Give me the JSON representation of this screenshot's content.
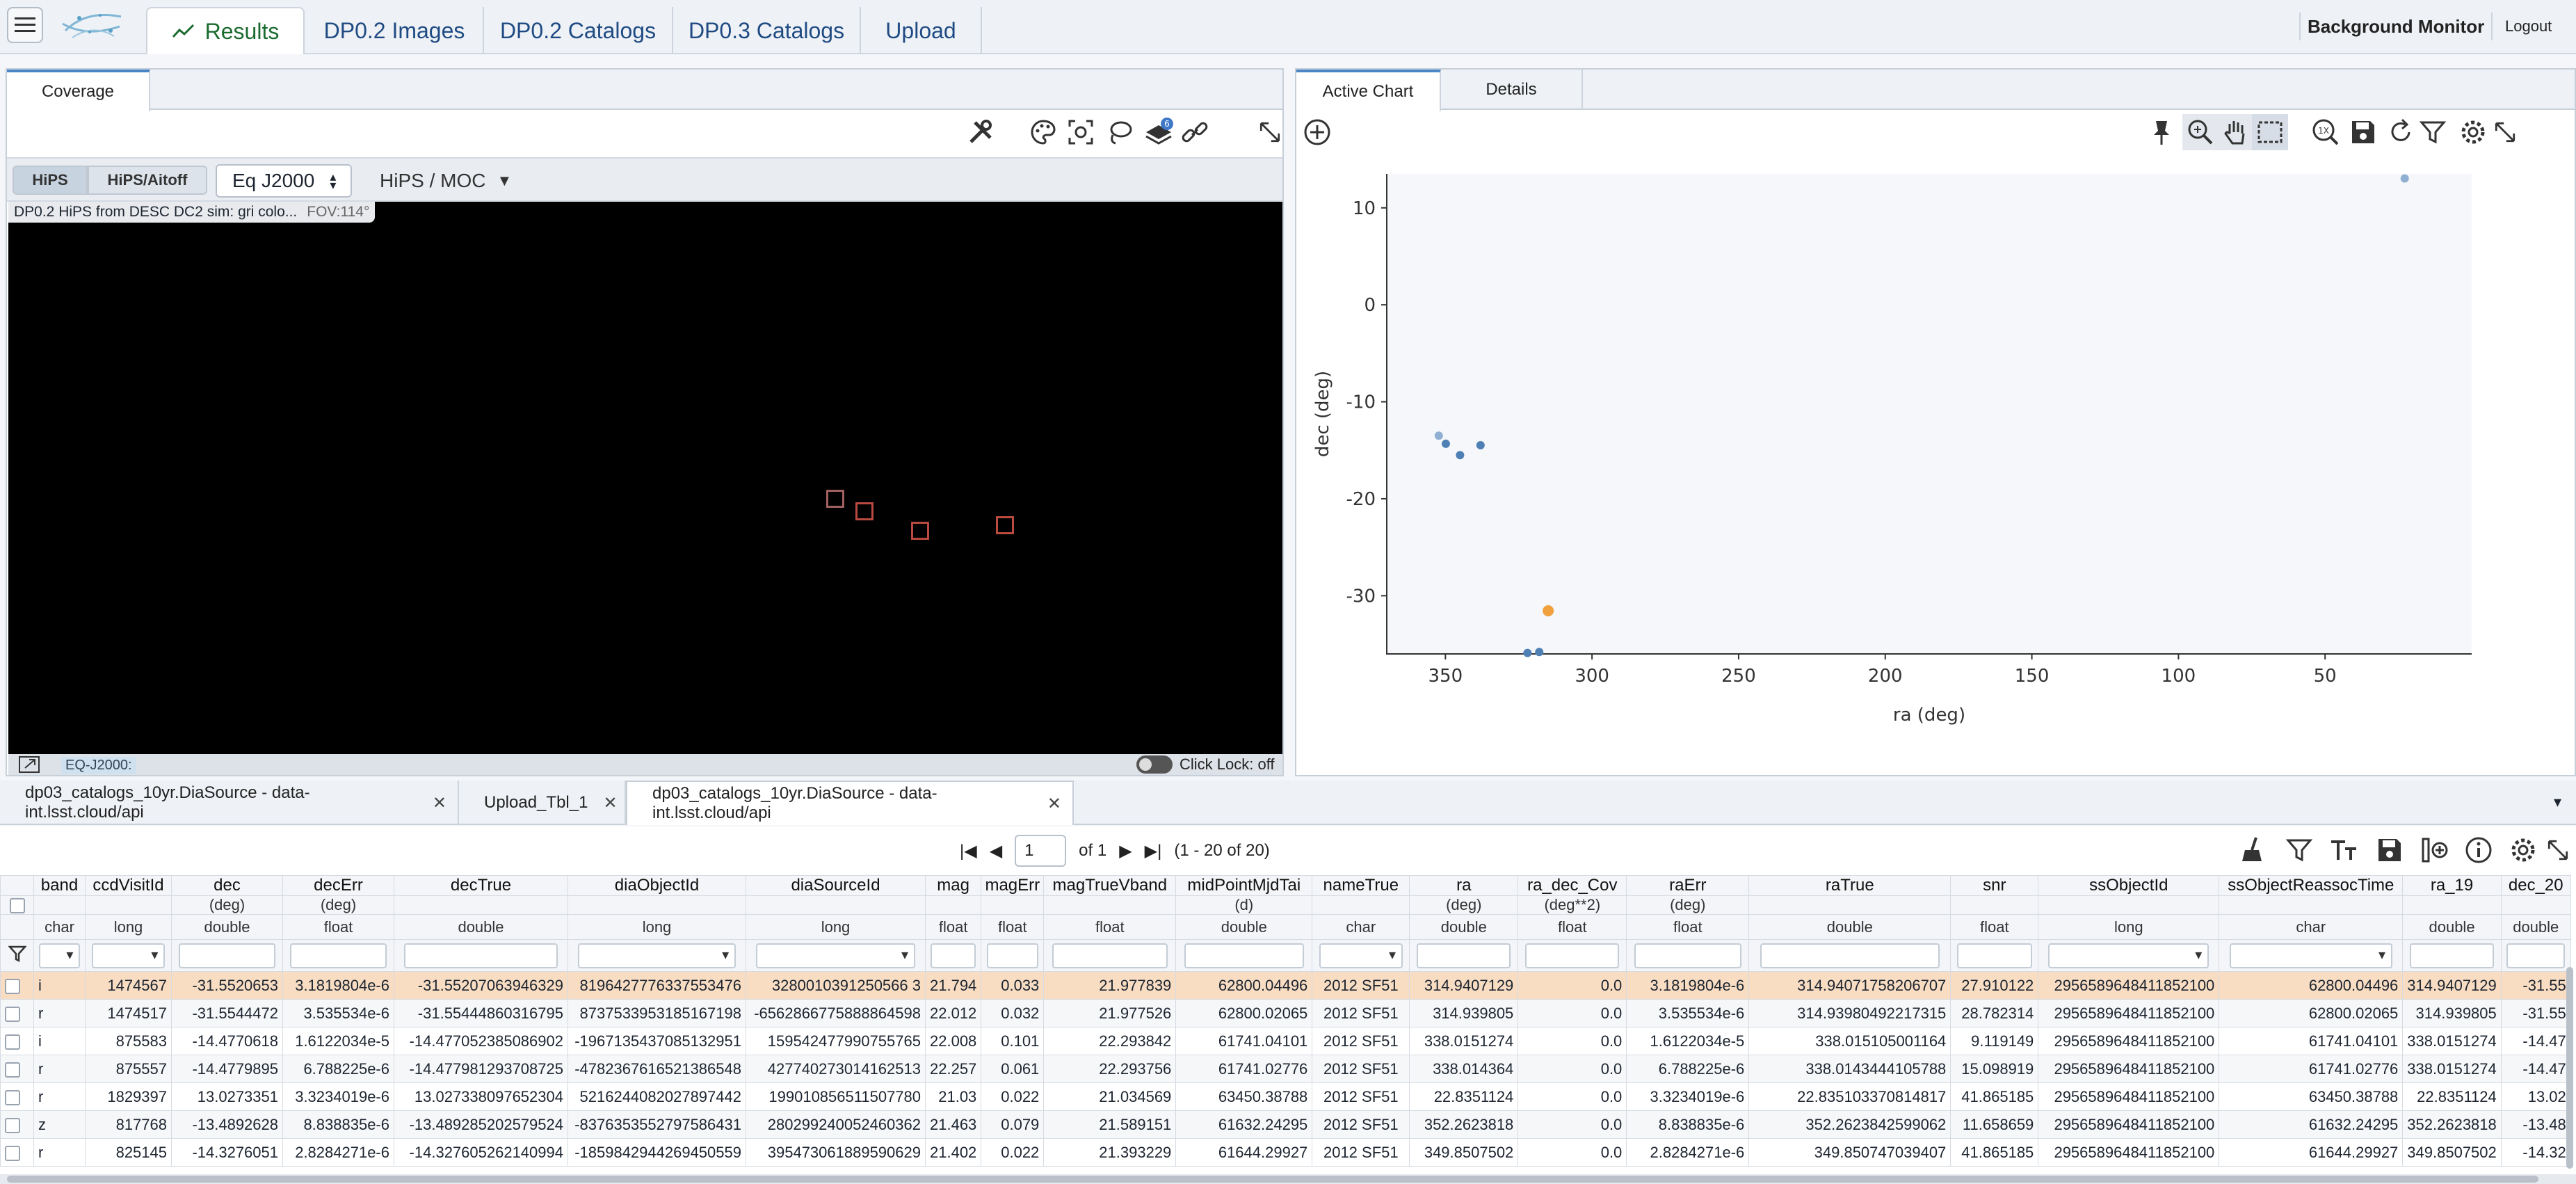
{
  "topbar": {
    "tabs": [
      {
        "label": "Results",
        "active": true
      },
      {
        "label": "DP0.2 Images"
      },
      {
        "label": "DP0.2 Catalogs"
      },
      {
        "label": "DP0.3 Catalogs"
      },
      {
        "label": "Upload"
      }
    ],
    "background_monitor": "Background Monitor",
    "logout": "Logout"
  },
  "coverage": {
    "tab": "Coverage",
    "layer_badge": "6",
    "hips_button": "HiPS",
    "aitoff_button": "HiPS/Aitoff",
    "coord_system": "Eq J2000",
    "hips_moc_menu": "HiPS / MOC",
    "image_title": "DP0.2 HiPS from DESC DC2 sim: gri colo...",
    "fov": "FOV:114°",
    "coord_label": "EQ-J2000:",
    "click_lock": "Click Lock: off"
  },
  "chart": {
    "tabs": [
      "Active Chart",
      "Details"
    ],
    "zoom_label": "1X"
  },
  "chart_data": {
    "type": "scatter",
    "xlabel": "ra (deg)",
    "ylabel": "dec (deg)",
    "xlim": [
      370,
      0
    ],
    "ylim": [
      -36,
      13.5
    ],
    "xticks": [
      350,
      300,
      250,
      200,
      150,
      100,
      50
    ],
    "yticks": [
      10,
      0,
      -10,
      -20,
      -30
    ],
    "points": [
      {
        "x": 352.26,
        "y": -13.49,
        "c": "#8fb0d3"
      },
      {
        "x": 349.85,
        "y": -14.33,
        "c": "#4f80b5"
      },
      {
        "x": 345.0,
        "y": -15.5,
        "c": "#4f80b5"
      },
      {
        "x": 338.02,
        "y": -14.48,
        "c": "#4f80b5"
      },
      {
        "x": 322.0,
        "y": -35.9,
        "c": "#4f80b5"
      },
      {
        "x": 318.0,
        "y": -35.8,
        "c": "#4f80b5"
      },
      {
        "x": 314.94,
        "y": -31.55,
        "c": "#f0a03c"
      },
      {
        "x": 22.84,
        "y": 13.03,
        "c": "#8fb0d3"
      }
    ]
  },
  "table_tabs": [
    {
      "label": "dp03_catalogs_10yr.DiaSource - data-int.lsst.cloud/api"
    },
    {
      "label": "Upload_Tbl_1"
    },
    {
      "label": "dp03_catalogs_10yr.DiaSource - data-int.lsst.cloud/api",
      "active": true
    }
  ],
  "pager": {
    "page": "1",
    "of": "of 1",
    "range": "(1 - 20 of 20)"
  },
  "table": {
    "columns": [
      {
        "name": "band",
        "unit": "",
        "type": "char",
        "dd": true
      },
      {
        "name": "ccdVisitId",
        "unit": "",
        "type": "long",
        "dd": true
      },
      {
        "name": "dec",
        "unit": "(deg)",
        "type": "double"
      },
      {
        "name": "decErr",
        "unit": "(deg)",
        "type": "float"
      },
      {
        "name": "decTrue",
        "unit": "",
        "type": "double"
      },
      {
        "name": "diaObjectId",
        "unit": "",
        "type": "long",
        "dd": true
      },
      {
        "name": "diaSourceId",
        "unit": "",
        "type": "long",
        "dd": true
      },
      {
        "name": "mag",
        "unit": "",
        "type": "float"
      },
      {
        "name": "magErr",
        "unit": "",
        "type": "float"
      },
      {
        "name": "magTrueVband",
        "unit": "",
        "type": "float"
      },
      {
        "name": "midPointMjdTai",
        "unit": "(d)",
        "type": "double"
      },
      {
        "name": "nameTrue",
        "unit": "",
        "type": "char",
        "dd": true
      },
      {
        "name": "ra",
        "unit": "(deg)",
        "type": "double"
      },
      {
        "name": "ra_dec_Cov",
        "unit": "(deg**2)",
        "type": "float"
      },
      {
        "name": "raErr",
        "unit": "(deg)",
        "type": "float"
      },
      {
        "name": "raTrue",
        "unit": "",
        "type": "double"
      },
      {
        "name": "snr",
        "unit": "",
        "type": "float"
      },
      {
        "name": "ssObjectId",
        "unit": "",
        "type": "long",
        "dd": true
      },
      {
        "name": "ssObjectReassocTime",
        "unit": "",
        "type": "char",
        "dd": true
      },
      {
        "name": "ra_19",
        "unit": "",
        "type": "double"
      },
      {
        "name": "dec_20",
        "unit": "",
        "type": "double"
      }
    ],
    "rows": [
      [
        "i",
        "1474567",
        "-31.5520653",
        "3.1819804e-6",
        "-31.55207063946329",
        "8196427776337553476",
        "3280010391250566 3",
        "21.794",
        "0.033",
        "21.977839",
        "62800.04496",
        "2012 SF51",
        "314.9407129",
        "0.0",
        "3.1819804e-6",
        "314.94071758206707",
        "27.910122",
        "2956589648411852100",
        "62800.04496",
        "314.9407129",
        "-31.55"
      ],
      [
        "r",
        "1474517",
        "-31.5544472",
        "3.535534e-6",
        "-31.55444860316795",
        "8737533953185167198",
        "-6562866775888864598",
        "22.012",
        "0.032",
        "21.977526",
        "62800.02065",
        "2012 SF51",
        "314.939805",
        "0.0",
        "3.535534e-6",
        "314.93980492217315",
        "28.782314",
        "2956589648411852100",
        "62800.02065",
        "314.939805",
        "-31.55"
      ],
      [
        "i",
        "875583",
        "-14.4770618",
        "1.6122034e-5",
        "-14.477052385086902",
        "-1967135437085132951",
        "159542477990755765",
        "22.008",
        "0.101",
        "22.293842",
        "61741.04101",
        "2012 SF51",
        "338.0151274",
        "0.0",
        "1.6122034e-5",
        "338.015105001164",
        "9.119149",
        "2956589648411852100",
        "61741.04101",
        "338.0151274",
        "-14.47"
      ],
      [
        "r",
        "875557",
        "-14.4779895",
        "6.788225e-6",
        "-14.477981293708725",
        "-4782367616521386548",
        "427740273014162513",
        "22.257",
        "0.061",
        "22.293756",
        "61741.02776",
        "2012 SF51",
        "338.014364",
        "0.0",
        "6.788225e-6",
        "338.0143444105788",
        "15.098919",
        "2956589648411852100",
        "61741.02776",
        "338.0151274",
        "-14.47"
      ],
      [
        "r",
        "1829397",
        "13.0273351",
        "3.3234019e-6",
        "13.027338097652304",
        "5216244082027897442",
        "199010856511507780",
        "21.03",
        "0.022",
        "21.034569",
        "63450.38788",
        "2012 SF51",
        "22.8351124",
        "0.0",
        "3.3234019e-6",
        "22.835103370814817",
        "41.865185",
        "2956589648411852100",
        "63450.38788",
        "22.8351124",
        "13.02"
      ],
      [
        "z",
        "817768",
        "-13.4892628",
        "8.838835e-6",
        "-13.489285202579524",
        "-8376353552797586431",
        "280299240052460362",
        "21.463",
        "0.079",
        "21.589151",
        "61632.24295",
        "2012 SF51",
        "352.2623818",
        "0.0",
        "8.838835e-6",
        "352.2623842599062",
        "11.658659",
        "2956589648411852100",
        "61632.24295",
        "352.2623818",
        "-13.48"
      ],
      [
        "r",
        "825145",
        "-14.3276051",
        "2.8284271e-6",
        "-14.327605262140994",
        "-1859842944269450559",
        "395473061889590629",
        "21.402",
        "0.022",
        "21.393229",
        "61644.29927",
        "2012 SF51",
        "349.8507502",
        "0.0",
        "2.8284271e-6",
        "349.850747039407",
        "41.865185",
        "2956589648411852100",
        "61644.29927",
        "349.8507502",
        "-14.32"
      ]
    ]
  }
}
